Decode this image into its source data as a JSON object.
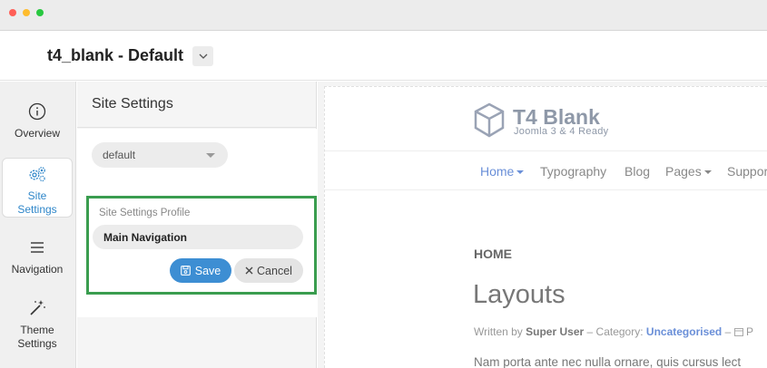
{
  "header": {
    "title": "t4_blank - Default"
  },
  "leftnav": {
    "items": [
      {
        "label1": "Overview",
        "label2": "",
        "icon": "info-icon"
      },
      {
        "label1": "Site",
        "label2": "Settings",
        "icon": "settings-gears-icon",
        "active": true
      },
      {
        "label1": "Navigation",
        "label2": "",
        "icon": "menu-lines-icon"
      },
      {
        "label1": "Theme",
        "label2": "Settings",
        "icon": "magic-wand-icon"
      }
    ]
  },
  "panel": {
    "title": "Site Settings",
    "profile_select": "default",
    "field_label": "Site Settings Profile",
    "profile_input_value": "Main Navigation",
    "save_label": "Save",
    "cancel_label": "Cancel"
  },
  "preview": {
    "logo_name": "T4 Blank",
    "logo_tagline": "Joomla 3 & 4 Ready",
    "menu": [
      "Home",
      "Typography",
      "Blog",
      "Pages",
      "Suppor"
    ],
    "breadcrumb": "HOME",
    "article_title": "Layouts",
    "meta": {
      "written_by": "Written by",
      "author": "Super User",
      "category_label": "– Category:",
      "category": "Uncategorised",
      "trailing": "– ",
      "trailing_letter": "P"
    },
    "body_text": "Nam porta ante nec nulla ornare, quis cursus lect"
  },
  "colors": {
    "accent": "#3d8ed3",
    "highlight": "#3a9d4f",
    "menu_active": "#6a8fd8"
  }
}
